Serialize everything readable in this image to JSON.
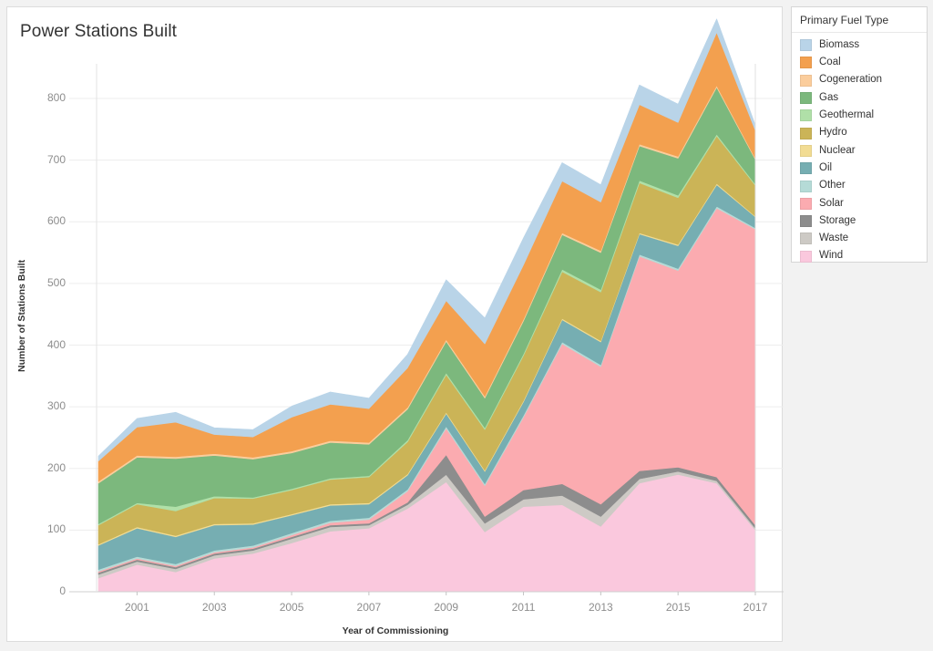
{
  "chart_card": {
    "title": "Power Stations Built"
  },
  "legend": {
    "title": "Primary Fuel Type",
    "items": [
      {
        "label": "Biomass",
        "color": "#b9d4e8"
      },
      {
        "label": "Coal",
        "color": "#f3a04f"
      },
      {
        "label": "Cogeneration",
        "color": "#fbcd9c"
      },
      {
        "label": "Gas",
        "color": "#7cb87d"
      },
      {
        "label": "Geothermal",
        "color": "#b0e0a8"
      },
      {
        "label": "Hydro",
        "color": "#cbb457"
      },
      {
        "label": "Nuclear",
        "color": "#f2dc93"
      },
      {
        "label": "Oil",
        "color": "#76aeb2"
      },
      {
        "label": "Other",
        "color": "#b5dbd7"
      },
      {
        "label": "Solar",
        "color": "#fbabb0"
      },
      {
        "label": "Storage",
        "color": "#8d8d8d"
      },
      {
        "label": "Waste",
        "color": "#cdcac5"
      },
      {
        "label": "Wind",
        "color": "#fac8dd"
      }
    ]
  },
  "chart_data": {
    "type": "area",
    "stacked": true,
    "title": "Power Stations Built",
    "xlabel": "Year of Commissioning",
    "ylabel": "Number of Stations Built",
    "xlim": [
      2000,
      2017
    ],
    "ylim": [
      0,
      800
    ],
    "y_ticks": [
      0,
      100,
      200,
      300,
      400,
      500,
      600,
      700,
      800
    ],
    "x_ticks": [
      2001,
      2003,
      2005,
      2007,
      2009,
      2011,
      2013,
      2015,
      2017
    ],
    "grid": true,
    "legend_position": "right",
    "x": [
      2000,
      2001,
      2002,
      2003,
      2004,
      2005,
      2006,
      2007,
      2008,
      2009,
      2010,
      2011,
      2012,
      2013,
      2014,
      2015,
      2016,
      2017
    ],
    "stack_order_bottom_to_top": [
      "Wind",
      "Waste",
      "Storage",
      "Solar",
      "Other",
      "Oil",
      "Nuclear",
      "Hydro",
      "Geothermal",
      "Gas",
      "Cogeneration",
      "Coal",
      "Biomass"
    ],
    "series": [
      {
        "name": "Wind",
        "color": "#fac8dd",
        "values": [
          22,
          44,
          32,
          54,
          62,
          79,
          98,
          103,
          135,
          178,
          97,
          138,
          141,
          106,
          176,
          190,
          176,
          100
        ]
      },
      {
        "name": "Waste",
        "color": "#cdcac5",
        "values": [
          6,
          5,
          5,
          5,
          5,
          7,
          7,
          5,
          6,
          12,
          14,
          12,
          15,
          16,
          7,
          5,
          4,
          3
        ]
      },
      {
        "name": "Storage",
        "color": "#8d8d8d",
        "values": [
          3,
          3,
          3,
          3,
          3,
          3,
          3,
          3,
          4,
          32,
          11,
          15,
          19,
          20,
          13,
          7,
          6,
          5
        ]
      },
      {
        "name": "Solar",
        "color": "#fbabb0",
        "values": [
          2,
          2,
          2,
          2,
          2,
          3,
          4,
          6,
          18,
          43,
          50,
          118,
          227,
          223,
          348,
          319,
          436,
          480
        ]
      },
      {
        "name": "Other",
        "color": "#b5dbd7",
        "values": [
          3,
          3,
          3,
          3,
          3,
          3,
          3,
          3,
          3,
          3,
          3,
          3,
          3,
          3,
          3,
          3,
          3,
          2
        ]
      },
      {
        "name": "Oil",
        "color": "#76aeb2",
        "values": [
          39,
          46,
          44,
          41,
          34,
          29,
          25,
          22,
          23,
          21,
          20,
          22,
          36,
          37,
          33,
          37,
          35,
          18
        ]
      },
      {
        "name": "Nuclear",
        "color": "#f2dc93",
        "values": [
          2,
          2,
          2,
          2,
          2,
          2,
          2,
          2,
          2,
          2,
          2,
          2,
          2,
          2,
          2,
          2,
          2,
          1
        ]
      },
      {
        "name": "Hydro",
        "color": "#cbb457",
        "values": [
          31,
          37,
          40,
          42,
          40,
          39,
          40,
          42,
          52,
          61,
          66,
          73,
          76,
          79,
          81,
          76,
          77,
          50
        ]
      },
      {
        "name": "Geothermal",
        "color": "#b0e0a8",
        "values": [
          2,
          2,
          7,
          3,
          2,
          2,
          2,
          2,
          3,
          3,
          3,
          3,
          4,
          4,
          4,
          4,
          3,
          2
        ]
      },
      {
        "name": "Gas",
        "color": "#7cb87d",
        "values": [
          66,
          74,
          78,
          66,
          62,
          58,
          58,
          51,
          50,
          51,
          48,
          53,
          56,
          60,
          56,
          60,
          76,
          40
        ]
      },
      {
        "name": "Cogeneration",
        "color": "#fbcd9c",
        "values": [
          3,
          3,
          3,
          3,
          3,
          3,
          3,
          3,
          3,
          3,
          3,
          3,
          3,
          3,
          3,
          3,
          3,
          2
        ]
      },
      {
        "name": "Coal",
        "color": "#f3a04f",
        "values": [
          33,
          46,
          56,
          31,
          33,
          55,
          59,
          55,
          64,
          63,
          85,
          88,
          84,
          79,
          64,
          55,
          86,
          45
        ]
      },
      {
        "name": "Biomass",
        "color": "#b9d4e8",
        "values": [
          8,
          14,
          16,
          11,
          12,
          18,
          20,
          17,
          22,
          34,
          42,
          44,
          30,
          28,
          32,
          30,
          22,
          9
        ]
      }
    ],
    "totals": [
      220,
      281,
      291,
      266,
      263,
      301,
      324,
      314,
      385,
      506,
      444,
      574,
      696,
      660,
      822,
      791,
      929,
      757
    ]
  }
}
